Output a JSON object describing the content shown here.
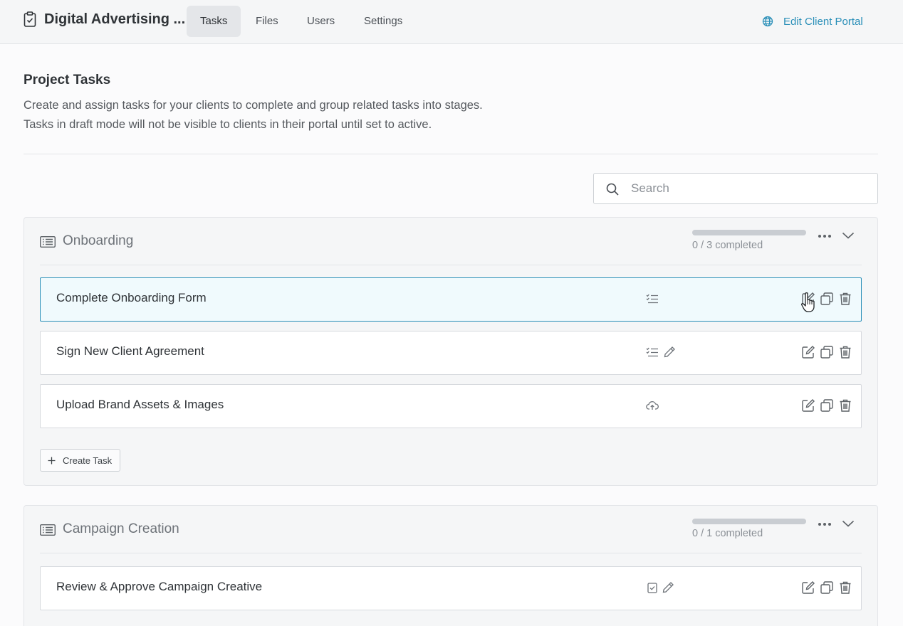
{
  "header": {
    "project_title": "Digital Advertising ...",
    "tabs": [
      {
        "label": "Tasks",
        "active": true
      },
      {
        "label": "Files",
        "active": false
      },
      {
        "label": "Users",
        "active": false
      },
      {
        "label": "Settings",
        "active": false
      }
    ],
    "portal_link": "Edit Client Portal"
  },
  "page": {
    "title": "Project Tasks",
    "description_line1": "Create and assign tasks for your clients to complete and group related tasks into stages.",
    "description_line2": "Tasks in draft mode will not be visible to clients in their portal until set to active."
  },
  "search": {
    "placeholder": "Search",
    "value": ""
  },
  "stages": [
    {
      "name": "Onboarding",
      "progress_text": "0 / 3 completed",
      "progress_fraction": 0,
      "tasks": [
        {
          "name": "Complete Onboarding Form",
          "type_icons": [
            "checklist-icon"
          ]
        },
        {
          "name": "Sign New Client Agreement",
          "type_icons": [
            "checklist-icon",
            "signature-pen-icon"
          ]
        },
        {
          "name": "Upload Brand Assets & Images",
          "type_icons": [
            "cloud-upload-icon"
          ]
        }
      ],
      "create_task_label": "Create Task"
    },
    {
      "name": "Campaign Creation",
      "progress_text": "0 / 1 completed",
      "progress_fraction": 0,
      "tasks": [
        {
          "name": "Review & Approve Campaign Creative",
          "type_icons": [
            "approval-checkbox-icon",
            "signature-pen-icon"
          ]
        }
      ]
    }
  ],
  "colors": {
    "accent": "#2a8fb8",
    "text": "#2f3337",
    "muted": "#8b9096"
  }
}
